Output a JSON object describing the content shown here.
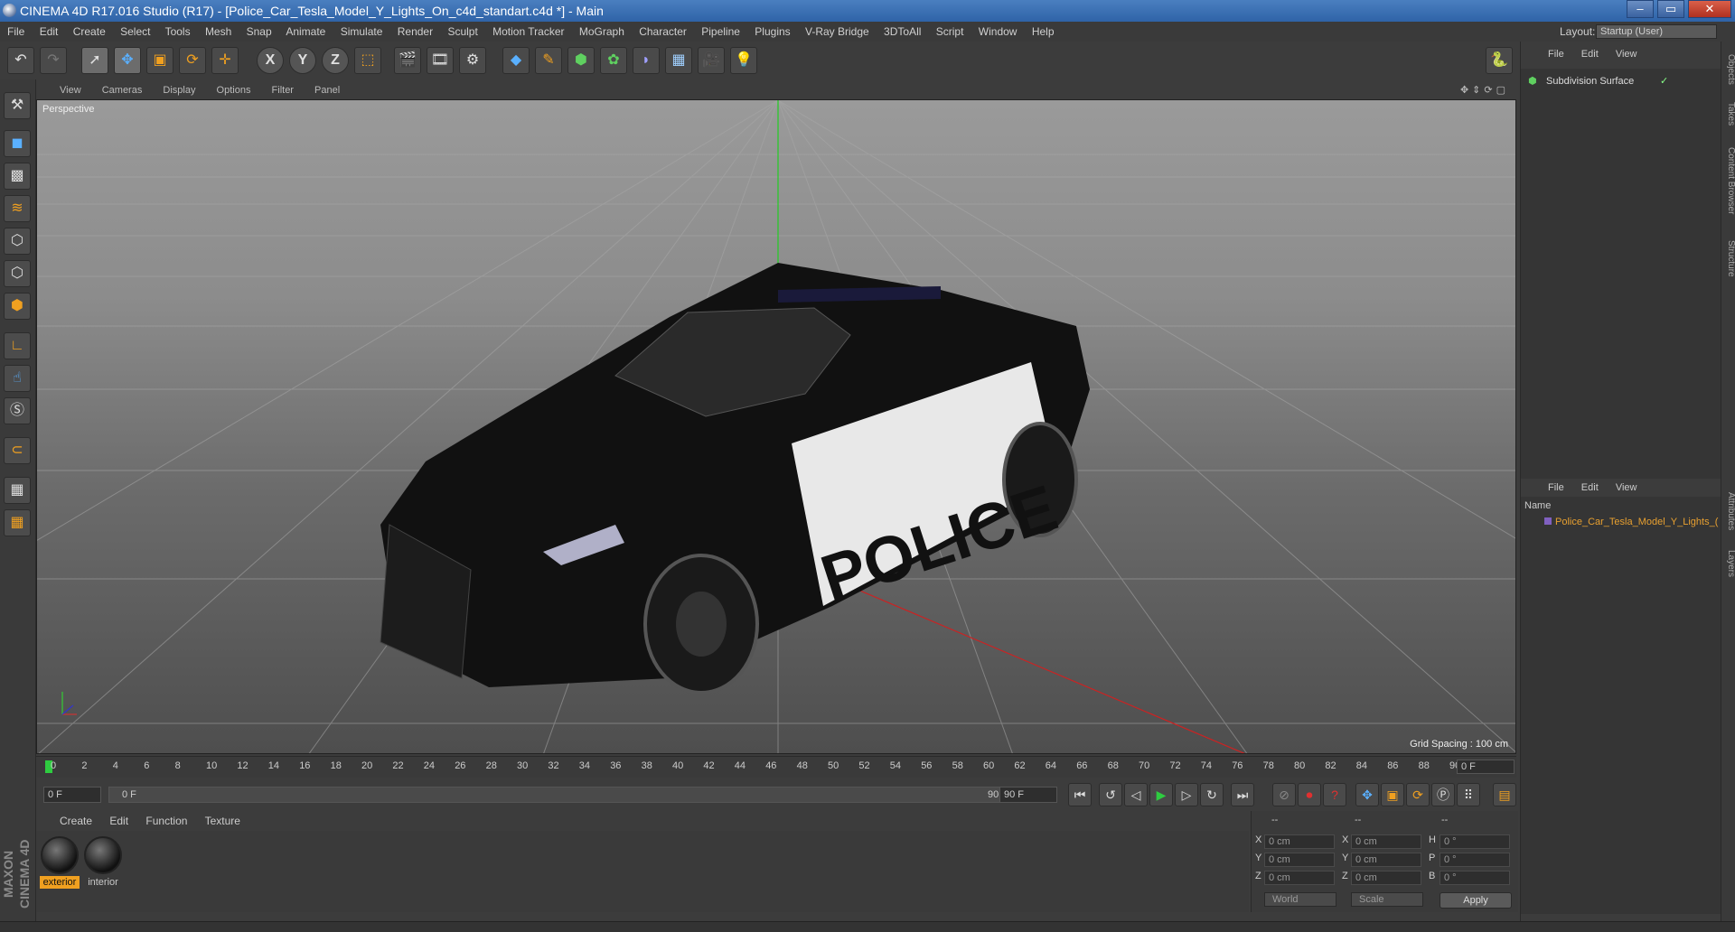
{
  "window": {
    "title": "CINEMA 4D R17.016 Studio (R17) - [Police_Car_Tesla_Model_Y_Lights_On_c4d_standart.c4d *] - Main",
    "controls": [
      "–",
      "▭",
      "✕"
    ]
  },
  "menubar": {
    "items": [
      "File",
      "Edit",
      "Create",
      "Select",
      "Tools",
      "Mesh",
      "Snap",
      "Animate",
      "Simulate",
      "Render",
      "Sculpt",
      "Motion Tracker",
      "MoGraph",
      "Character",
      "Pipeline",
      "Plugins",
      "V-Ray Bridge",
      "3DToAll",
      "Script",
      "Window",
      "Help"
    ],
    "layout_label": "Layout:",
    "layout_value": "Startup (User)"
  },
  "toolbar": {
    "axis_x": "X",
    "axis_y": "Y",
    "axis_z": "Z"
  },
  "viewport": {
    "menu": [
      "View",
      "Cameras",
      "Display",
      "Options",
      "Filter",
      "Panel"
    ],
    "label": "Perspective",
    "grid_spacing": "Grid Spacing : 100 cm",
    "decal_text": "POLICE"
  },
  "timeline": {
    "ticks": [
      "0",
      "2",
      "4",
      "6",
      "8",
      "10",
      "12",
      "14",
      "16",
      "18",
      "20",
      "22",
      "24",
      "26",
      "28",
      "30",
      "32",
      "34",
      "36",
      "38",
      "40",
      "42",
      "44",
      "46",
      "48",
      "50",
      "52",
      "54",
      "56",
      "58",
      "60",
      "62",
      "64",
      "66",
      "68",
      "70",
      "72",
      "74",
      "76",
      "78",
      "80",
      "82",
      "84",
      "86",
      "88",
      "90"
    ],
    "frame_end": "0 F"
  },
  "playback": {
    "current_frame": "0 F",
    "range_start": "0 F",
    "range_end": "90 F",
    "max_frame": "90 F"
  },
  "materials": {
    "menu": [
      "Create",
      "Edit",
      "Function",
      "Texture"
    ],
    "items": [
      {
        "name": "exterior",
        "selected": true
      },
      {
        "name": "interior",
        "selected": false
      }
    ]
  },
  "coordinates": {
    "header": [
      "--",
      "--",
      "--"
    ],
    "rows": [
      {
        "k1": "X",
        "v1": "0 cm",
        "k2": "X",
        "v2": "0 cm",
        "k3": "H",
        "v3": "0 °"
      },
      {
        "k1": "Y",
        "v1": "0 cm",
        "k2": "Y",
        "v2": "0 cm",
        "k3": "P",
        "v3": "0 °"
      },
      {
        "k1": "Z",
        "v1": "0 cm",
        "k2": "Z",
        "v2": "0 cm",
        "k3": "B",
        "v3": "0 °"
      }
    ],
    "mode_world": "World",
    "mode_scale": "Scale",
    "apply": "Apply"
  },
  "objects_panel": {
    "menu": [
      "File",
      "Edit",
      "View"
    ],
    "object_name": "Subdivision Surface"
  },
  "layers_panel": {
    "menu": [
      "File",
      "Edit",
      "View"
    ],
    "column_name": "Name",
    "layer_name": "Police_Car_Tesla_Model_Y_Lights_("
  },
  "side_tabs": [
    "Objects",
    "Takes",
    "Content Browser",
    "Structure",
    "Attributes",
    "Layers"
  ],
  "brand": "MAXON CINEMA 4D",
  "colors": {
    "title_bar": "#3a6db3",
    "accent_orange": "#f0a020",
    "layer_color": "#e8a030"
  }
}
